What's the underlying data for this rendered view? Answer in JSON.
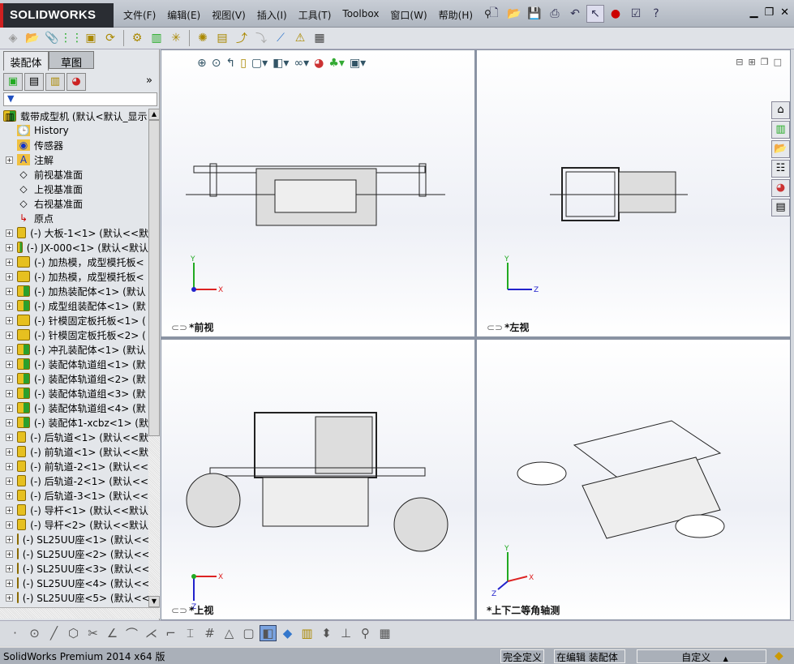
{
  "app": {
    "logo": "SOLIDWORKS",
    "status_text": "SolidWorks Premium 2014 x64 版"
  },
  "menu": [
    "文件(F)",
    "编辑(E)",
    "视图(V)",
    "插入(I)",
    "工具(T)",
    "Toolbox",
    "窗口(W)",
    "帮助(H)"
  ],
  "panel": {
    "tabs": [
      "装配体",
      "草图"
    ],
    "more": "»",
    "filter": "▼"
  },
  "tree": [
    {
      "label": "载带成型机  (默认<默认_显示",
      "type": "root",
      "expand": false
    },
    {
      "label": "History",
      "type": "history",
      "expand": false
    },
    {
      "label": "传感器",
      "type": "sensor",
      "expand": false
    },
    {
      "label": "注解",
      "type": "annot",
      "expand": true
    },
    {
      "label": "前视基准面",
      "type": "plane",
      "expand": false
    },
    {
      "label": "上视基准面",
      "type": "plane",
      "expand": false
    },
    {
      "label": "右视基准面",
      "type": "plane",
      "expand": false
    },
    {
      "label": "原点",
      "type": "origin",
      "expand": false
    },
    {
      "label": "(-) 大板-1<1> (默认<<默",
      "type": "part",
      "expand": true
    },
    {
      "label": "(-) JX-000<1> (默认<默认",
      "type": "asm",
      "expand": true
    },
    {
      "label": "(-) 加热模，成型模托板<",
      "type": "part",
      "expand": true
    },
    {
      "label": "(-) 加热模，成型模托板<",
      "type": "part",
      "expand": true
    },
    {
      "label": "(-) 加热装配体<1> (默认",
      "type": "asm",
      "expand": true
    },
    {
      "label": "(-) 成型组装配体<1> (默",
      "type": "asm",
      "expand": true
    },
    {
      "label": "(-) 针模固定板托板<1> (",
      "type": "part",
      "expand": true
    },
    {
      "label": "(-) 针模固定板托板<2> (",
      "type": "part",
      "expand": true
    },
    {
      "label": "(-) 冲孔装配体<1> (默认",
      "type": "asm",
      "expand": true
    },
    {
      "label": "(-) 装配体轨道组<1> (默",
      "type": "asm",
      "expand": true
    },
    {
      "label": "(-) 装配体轨道组<2> (默",
      "type": "asm",
      "expand": true
    },
    {
      "label": "(-) 装配体轨道组<3> (默",
      "type": "asm",
      "expand": true
    },
    {
      "label": "(-) 装配体轨道组<4> (默",
      "type": "asm",
      "expand": true
    },
    {
      "label": "(-) 装配体1-xcbz<1> (默",
      "type": "asm",
      "expand": true
    },
    {
      "label": "(-) 后轨道<1> (默认<<默",
      "type": "part",
      "expand": true
    },
    {
      "label": "(-) 前轨道<1> (默认<<默",
      "type": "part",
      "expand": true
    },
    {
      "label": "(-) 前轨道-2<1> (默认<<",
      "type": "part",
      "expand": true
    },
    {
      "label": "(-) 后轨道-2<1> (默认<<",
      "type": "part",
      "expand": true
    },
    {
      "label": "(-) 后轨道-3<1> (默认<<",
      "type": "part",
      "expand": true
    },
    {
      "label": "(-) 导杆<1> (默认<<默认",
      "type": "part",
      "expand": true
    },
    {
      "label": "(-) 导杆<2> (默认<<默认",
      "type": "part",
      "expand": true
    },
    {
      "label": "(-) SL25UU座<1> (默认<<",
      "type": "part",
      "expand": true
    },
    {
      "label": "(-) SL25UU座<2> (默认<<",
      "type": "part",
      "expand": true
    },
    {
      "label": "(-) SL25UU座<3> (默认<<",
      "type": "part",
      "expand": true
    },
    {
      "label": "(-) SL25UU座<4> (默认<<",
      "type": "part",
      "expand": true
    },
    {
      "label": "(-) SL25UU座<5> (默认<<",
      "type": "part",
      "expand": true
    }
  ],
  "views": {
    "front": "*前视",
    "left": "*左视",
    "top": "*上视",
    "iso": "*上下二等角轴测"
  },
  "axes": {
    "x": "X",
    "y": "Y",
    "z": "Z"
  },
  "status": {
    "defined": "完全定义",
    "editing": "在编辑 装配体",
    "units": "自定义",
    "units_arrow": "▲"
  }
}
